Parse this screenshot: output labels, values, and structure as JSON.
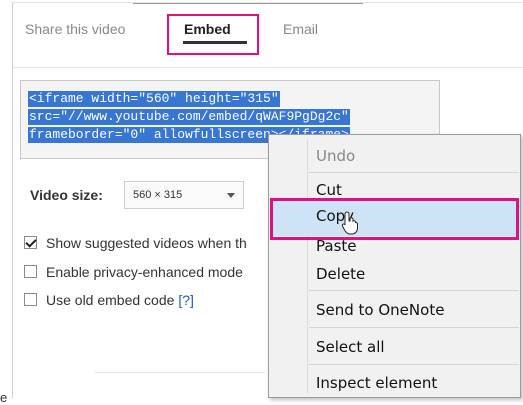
{
  "tabs": {
    "share_label": "Share this video",
    "embed_label": "Embed",
    "email_label": "Email"
  },
  "embed_code": {
    "line1": "<iframe width=\"560\" height=\"315\"",
    "line2": "src=\"//www.youtube.com/embed/qWAF9PgDg2c\"",
    "line3": "frameborder=\"0\" allowfullscreen></iframe>"
  },
  "video_size": {
    "label": "Video size:",
    "value": "560 × 315"
  },
  "options": [
    {
      "label": "Show suggested videos when th",
      "checked": true
    },
    {
      "label": "Enable privacy-enhanced mode",
      "checked": false
    },
    {
      "label": "Use old embed code ",
      "help": "[?]",
      "checked": false
    }
  ],
  "stray_text": "e",
  "context_menu": {
    "items": [
      "Undo",
      "Cut",
      "Copy",
      "Paste",
      "Delete",
      "Send to OneNote",
      "Select all",
      "Inspect element"
    ],
    "disabled": [
      "Undo"
    ],
    "highlighted": "Copy"
  },
  "colors": {
    "highlight_box": "#e0117f",
    "selection": "#3876d3",
    "menu_hover": "#cfe3f7"
  }
}
